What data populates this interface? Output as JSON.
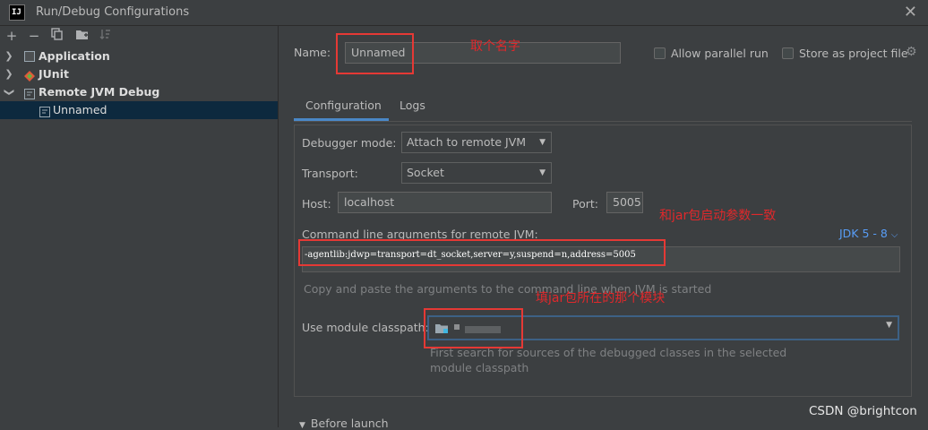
{
  "window": {
    "title": "Run/Debug Configurations",
    "logo": "IJ"
  },
  "toolbar": {
    "add": "+",
    "remove": "−",
    "copy": "copy-icon",
    "folder": "folder-icon",
    "sort": "sort-icon"
  },
  "tree": {
    "application": "Application",
    "junit": "JUnit",
    "remote_jvm_debug": "Remote JVM Debug",
    "unnamed": "Unnamed"
  },
  "form": {
    "name_label": "Name:",
    "name_value": "Unnamed",
    "allow_parallel": "Allow parallel run",
    "store_project_file": "Store as project file",
    "tab_configuration": "Configuration",
    "tab_logs": "Logs",
    "debugger_mode_label": "Debugger mode:",
    "debugger_mode_value": "Attach to remote JVM",
    "transport_label": "Transport:",
    "transport_value": "Socket",
    "host_label": "Host:",
    "host_value": "localhost",
    "port_label": "Port:",
    "port_value": "5005",
    "cmd_label": "Command line arguments for remote JVM:",
    "jdk_link": "JDK 5 - 8",
    "cmd_value": "-agentlib:jdwp=transport=dt_socket,server=y,suspend=n,address=5005",
    "cmd_hint": "Copy and paste the arguments to the command line when JVM is started",
    "module_label": "Use module classpath:",
    "module_hint_1": "First search for sources of the debugged classes in the selected",
    "module_hint_2": "module classpath",
    "before_launch": "Before launch"
  },
  "annotations": {
    "name": "取个名字",
    "cmd": "和jar包启动参数一致",
    "module": "填jar包所在的那个模块"
  },
  "watermark": "CSDN @brightcon",
  "colors": {
    "accent": "#4a88c7",
    "annotation": "#e53935",
    "link": "#589df6",
    "selection": "#0d293e"
  }
}
